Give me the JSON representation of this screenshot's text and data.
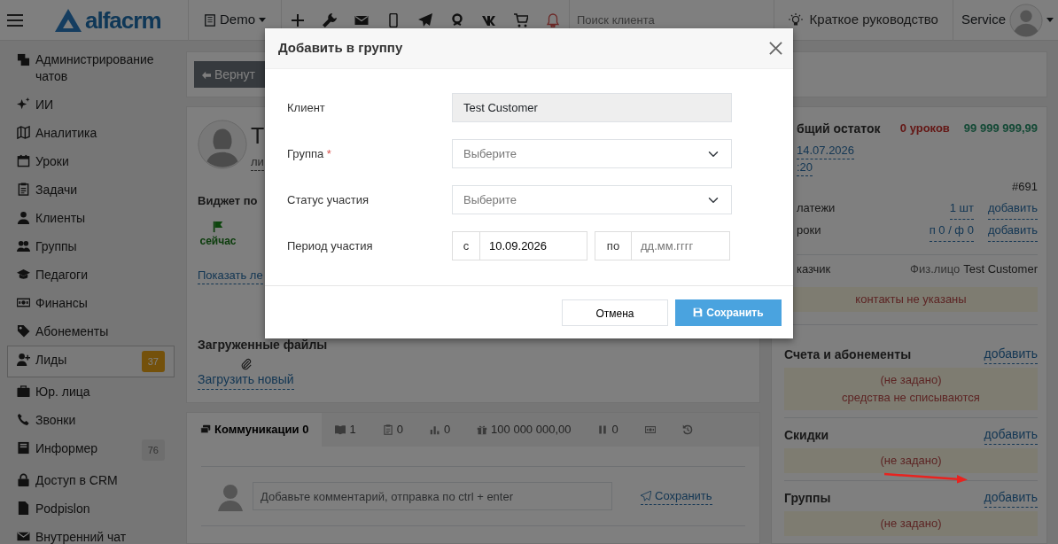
{
  "topbar": {
    "brand": "alfacrm",
    "branch": "Demo",
    "search_placeholder": "Поиск клиента",
    "guide": "Краткое руководство",
    "user": "Service"
  },
  "sidebar": {
    "items": [
      {
        "label": "Администрирование чатов",
        "selected": false
      },
      {
        "label": "ИИ",
        "selected": false
      },
      {
        "label": "Аналитика",
        "selected": false
      },
      {
        "label": "Уроки",
        "selected": false
      },
      {
        "label": "Задачи",
        "selected": false
      },
      {
        "label": "Клиенты",
        "selected": false
      },
      {
        "label": "Группы",
        "selected": false
      },
      {
        "label": "Педагоги",
        "selected": false
      },
      {
        "label": "Финансы",
        "selected": false
      },
      {
        "label": "Абонементы",
        "selected": false
      },
      {
        "label": "Лиды",
        "selected": true,
        "badge": {
          "text": "37",
          "kind": "warning"
        }
      },
      {
        "label": "Юр. лица",
        "selected": false
      },
      {
        "label": "Звонки",
        "selected": false
      },
      {
        "label": "Информер",
        "selected": false,
        "badge": {
          "text": "76",
          "kind": "muted"
        }
      },
      {
        "label": "Доступ в CRM",
        "selected": false
      },
      {
        "label": "Podpislon",
        "selected": false
      },
      {
        "label": "Внутренний чат",
        "selected": false
      }
    ]
  },
  "back_button": "Вернут",
  "profile": {
    "name": "Т",
    "subtitle": "ли",
    "widget_title": "Виджет по",
    "widget_tile": "сейчас",
    "show_link": "Показать ле",
    "files_title": "Загруженные файлы",
    "upload_link": "Загрузить новый"
  },
  "tabs": [
    {
      "label": "Коммуникации 0",
      "selected": true
    },
    {
      "label": "1",
      "selected": false
    },
    {
      "label": "0",
      "selected": false
    },
    {
      "label": "0",
      "selected": false
    },
    {
      "label": "100 000 000,00",
      "selected": false
    },
    {
      "label": "0",
      "selected": false
    },
    {
      "selected": false
    },
    {
      "selected": false
    }
  ],
  "comment": {
    "placeholder": "Добавьте комментарий, отправка по ctrl + enter",
    "save": "Сохранить"
  },
  "summary": {
    "balance_label": "бщий остаток",
    "lessons_left": "0 уроков",
    "money_left": "99 999 999,99",
    "date": "14.07.2026",
    "time": ":20",
    "number": "#691",
    "rows": [
      {
        "label": "латежи",
        "value": "1 шт",
        "action": "добавить"
      },
      {
        "label": "роки",
        "value": "п 0 / ф 0",
        "action": "добавить"
      }
    ],
    "payer_label": "казчик",
    "payer_type": "Физ.лицо",
    "payer_name": "Test Customer",
    "contacts_note": "контакты не указаны",
    "sections": [
      {
        "title": "Счета и абонементы",
        "action": "добавить",
        "notes": [
          "(не задано)",
          "средства не списываются"
        ]
      },
      {
        "title": "Скидки",
        "action": "добавить",
        "notes": [
          "(не задано)"
        ]
      },
      {
        "title": "Группы",
        "action": "добавить",
        "notes": [
          "(не задано)"
        ]
      }
    ]
  },
  "modal": {
    "title": "Добавить в группу",
    "fields": [
      {
        "kind": "readonly",
        "label": "Клиент",
        "value": "Test Customer"
      },
      {
        "kind": "select",
        "label": "Группа",
        "required_mark": "*",
        "placeholder": "Выберите"
      },
      {
        "kind": "select",
        "label": "Статус участия",
        "placeholder": "Выберите"
      },
      {
        "kind": "period",
        "label": "Период участия",
        "from_label": "с",
        "from_value": "10.09.2026",
        "to_label": "по",
        "to_placeholder": "дд.мм.гггг"
      }
    ],
    "cancel": "Отмена",
    "save": "Сохранить"
  }
}
